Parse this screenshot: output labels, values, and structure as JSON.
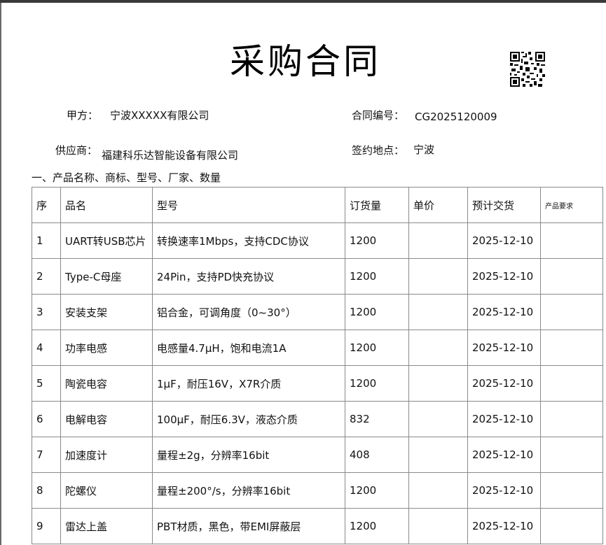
{
  "title": "采购合同",
  "party_a": {
    "label": "甲方：",
    "value": "宁波XXXXX有限公司"
  },
  "contract_no": {
    "label": "合同编号：",
    "value": "CG2025120009"
  },
  "supplier": {
    "label": "供应商：",
    "value": "福建科乐达智能设备有限公司"
  },
  "sign_place": {
    "label": "签约地点：",
    "value": "宁波"
  },
  "section_title": "一、产品名称、商标、型号、厂家、数量",
  "table": {
    "headers": [
      "序",
      "品名",
      "型号",
      "订货量",
      "单价",
      "预计交货",
      "产品要求"
    ],
    "rows": [
      [
        "1",
        "UART转USB芯片",
        "转换速率1Mbps，支持CDC协议",
        "1200",
        "",
        "2025-12-10",
        ""
      ],
      [
        "2",
        "Type-C母座",
        "24Pin，支持PD快充协议",
        "1200",
        "",
        "2025-12-10",
        ""
      ],
      [
        "3",
        "安装支架",
        "铝合金，可调角度（0~30°）",
        "1200",
        "",
        "2025-12-10",
        ""
      ],
      [
        "4",
        "功率电感",
        "电感量4.7μH，饱和电流1A",
        "1200",
        "",
        "2025-12-10",
        ""
      ],
      [
        "5",
        "陶瓷电容",
        "1μF，耐压16V，X7R介质",
        "1200",
        "",
        "2025-12-10",
        ""
      ],
      [
        "6",
        "电解电容",
        "100μF，耐压6.3V，液态介质",
        "832",
        "",
        "2025-12-10",
        ""
      ],
      [
        "7",
        "加速度计",
        "量程±2g，分辨率16bit",
        "408",
        "",
        "2025-12-10",
        ""
      ],
      [
        "8",
        "陀螺仪",
        "量程±200°/s，分辨率16bit",
        "1200",
        "",
        "2025-12-10",
        ""
      ],
      [
        "9",
        "雷达上盖",
        "PBT材质，黑色，带EMI屏蔽层",
        "1200",
        "",
        "2025-12-10",
        ""
      ]
    ]
  }
}
